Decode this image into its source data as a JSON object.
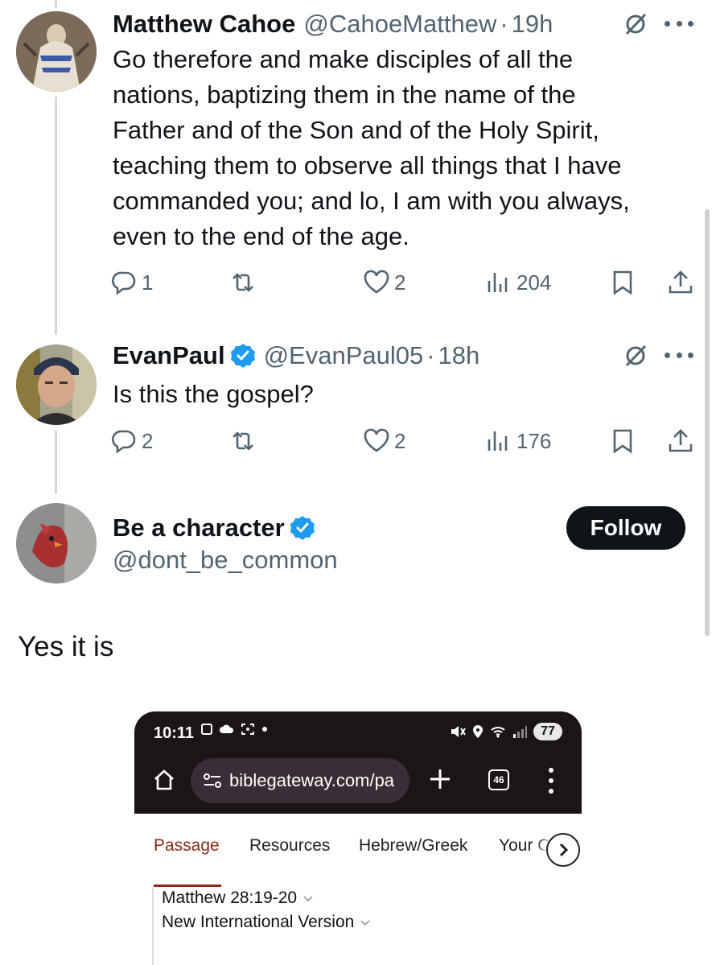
{
  "colors": {
    "text": "#0f1419",
    "secondary": "#536471",
    "verified_blue": "#1d9bf0",
    "thread_line": "#cfd9de",
    "follow_bg": "#0f1419",
    "bible_accent": "#8a2a16",
    "browser_bar": "#1b1418"
  },
  "tweets": [
    {
      "name": "Matthew Cahoe",
      "handle": "@CahoeMatthew",
      "dot": "·",
      "time": "19h",
      "verified": false,
      "text_lines": [
        "Go therefore and make disciples of all the",
        "nations, baptizing them in the name of the",
        "Father and of the Son and of the Holy Spirit,",
        "teaching them to observe all things that I have",
        "commanded you; and lo, I am with you always,",
        "even to the end of the age."
      ],
      "replies": "1",
      "retweets": "",
      "likes": "2",
      "views": "204"
    },
    {
      "name": "EvanPaul",
      "handle": "@EvanPaul05",
      "dot": "·",
      "time": "18h",
      "verified": true,
      "text_lines": [
        "Is this the gospel?"
      ],
      "replies": "2",
      "retweets": "",
      "likes": "2",
      "views": "176"
    }
  ],
  "focused": {
    "name": "Be a character",
    "handle": "@dont_be_common",
    "verified": true,
    "follow_label": "Follow",
    "text": "Yes it is"
  },
  "embedded_screenshot": {
    "status_time": "10:11",
    "battery": "77",
    "url": "biblegateway.com/pa",
    "tab_count": "46",
    "nav_tabs": [
      "Passage",
      "Resources",
      "Hebrew/Greek",
      "Your C"
    ],
    "active_tab": "Passage",
    "passage_ref": "Matthew 28:19-20",
    "version": "New International Version"
  },
  "icons": {
    "reply": "reply-bubble-icon",
    "retweet": "retweet-icon",
    "like": "heart-icon",
    "views": "views-bar-chart-icon",
    "bookmark": "bookmark-icon",
    "share": "share-upload-icon",
    "grok": "grok-slash-icon",
    "more": "more-dots-icon",
    "verified": "verified-badge-icon"
  }
}
